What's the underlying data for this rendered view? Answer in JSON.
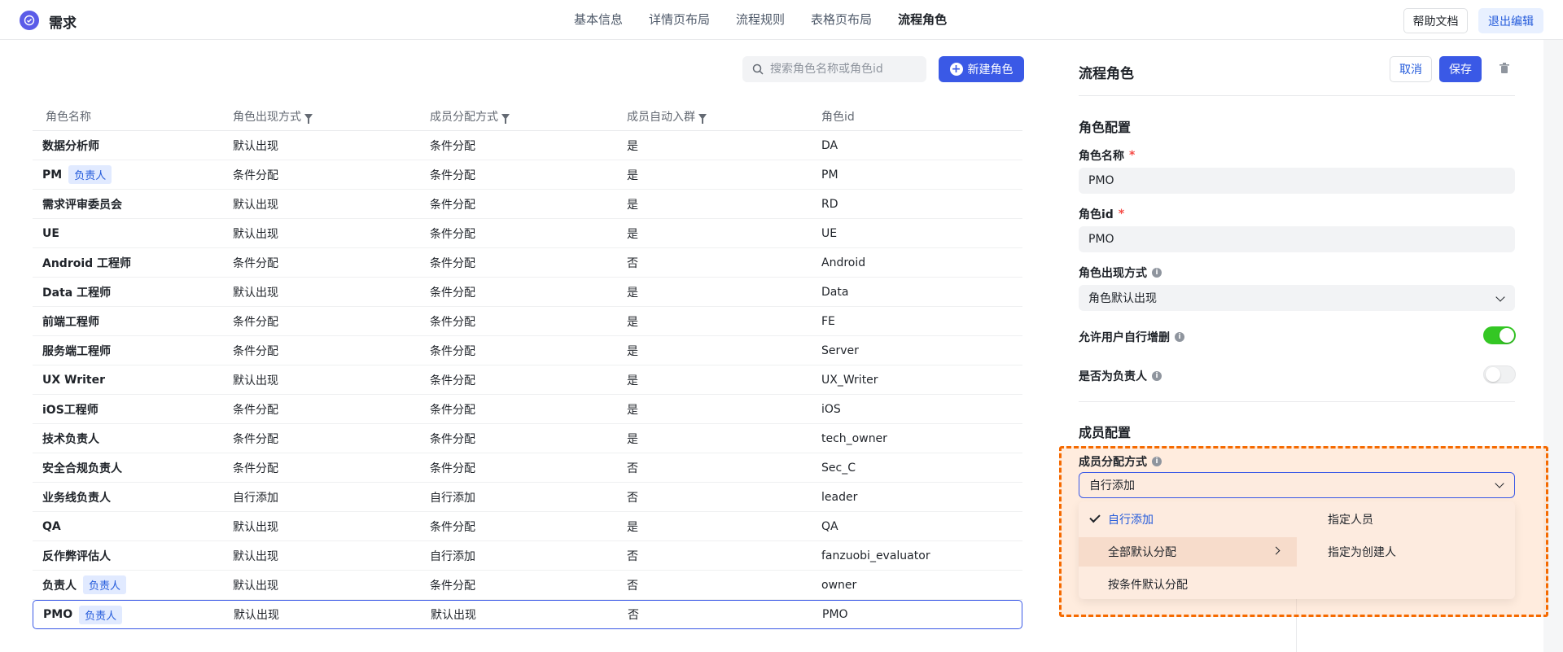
{
  "app": {
    "title": "需求"
  },
  "nav": {
    "items": [
      "基本信息",
      "详情页布局",
      "流程规则",
      "表格页布局",
      "流程角色"
    ],
    "active": 4
  },
  "header": {
    "help_label": "帮助文档",
    "exit_label": "退出编辑"
  },
  "toolbar": {
    "search_placeholder": "搜索角色名称或角色id",
    "new_label": "新建角色"
  },
  "table": {
    "columns": [
      "角色名称",
      "角色出现方式",
      "成员分配方式",
      "成员自动入群",
      "角色id"
    ],
    "rows": [
      {
        "name": "数据分析师",
        "tag": "",
        "appear": "默认出现",
        "assign": "条件分配",
        "auto": "是",
        "id": "DA"
      },
      {
        "name": "PM",
        "tag": "负责人",
        "appear": "条件分配",
        "assign": "条件分配",
        "auto": "是",
        "id": "PM"
      },
      {
        "name": "需求评审委员会",
        "tag": "",
        "appear": "默认出现",
        "assign": "条件分配",
        "auto": "是",
        "id": "RD"
      },
      {
        "name": "UE",
        "tag": "",
        "appear": "默认出现",
        "assign": "条件分配",
        "auto": "是",
        "id": "UE"
      },
      {
        "name": "Android 工程师",
        "tag": "",
        "appear": "条件分配",
        "assign": "条件分配",
        "auto": "否",
        "id": "Android"
      },
      {
        "name": "Data 工程师",
        "tag": "",
        "appear": "默认出现",
        "assign": "条件分配",
        "auto": "是",
        "id": "Data"
      },
      {
        "name": "前端工程师",
        "tag": "",
        "appear": "条件分配",
        "assign": "条件分配",
        "auto": "是",
        "id": "FE"
      },
      {
        "name": "服务端工程师",
        "tag": "",
        "appear": "条件分配",
        "assign": "条件分配",
        "auto": "是",
        "id": "Server"
      },
      {
        "name": "UX Writer",
        "tag": "",
        "appear": "默认出现",
        "assign": "条件分配",
        "auto": "是",
        "id": "UX_Writer"
      },
      {
        "name": "iOS工程师",
        "tag": "",
        "appear": "条件分配",
        "assign": "条件分配",
        "auto": "是",
        "id": "iOS"
      },
      {
        "name": "技术负责人",
        "tag": "",
        "appear": "条件分配",
        "assign": "条件分配",
        "auto": "是",
        "id": "tech_owner"
      },
      {
        "name": "安全合规负责人",
        "tag": "",
        "appear": "条件分配",
        "assign": "条件分配",
        "auto": "否",
        "id": "Sec_C"
      },
      {
        "name": "业务线负责人",
        "tag": "",
        "appear": "自行添加",
        "assign": "自行添加",
        "auto": "否",
        "id": "leader"
      },
      {
        "name": "QA",
        "tag": "",
        "appear": "默认出现",
        "assign": "条件分配",
        "auto": "是",
        "id": "QA"
      },
      {
        "name": "反作弊评估人",
        "tag": "",
        "appear": "默认出现",
        "assign": "自行添加",
        "auto": "否",
        "id": "fanzuobi_evaluator"
      },
      {
        "name": "负责人",
        "tag": "负责人",
        "appear": "默认出现",
        "assign": "条件分配",
        "auto": "否",
        "id": "owner"
      },
      {
        "name": "PMO",
        "tag": "负责人",
        "appear": "默认出现",
        "assign": "默认出现",
        "auto": "否",
        "id": "PMO"
      }
    ]
  },
  "panel": {
    "title": "流程角色",
    "cancel_label": "取消",
    "save_label": "保存",
    "role_section": "角色配置",
    "name_label": "角色名称",
    "name_value": "PMO",
    "id_label": "角色id",
    "id_value": "PMO",
    "appear_label": "角色出现方式",
    "appear_value": "角色默认出现",
    "allow_edit_label": "允许用户自行增删",
    "allow_edit_on": true,
    "is_owner_label": "是否为负责人",
    "is_owner_on": false,
    "member_section": "成员配置",
    "assign_label": "成员分配方式",
    "assign_value": "自行添加",
    "menu_left": [
      "自行添加",
      "全部默认分配",
      "按条件默认分配"
    ],
    "menu_right": [
      "指定人员",
      "指定为创建人"
    ]
  },
  "colors": {
    "accent": "#3a59e6",
    "toggle_on": "#34c724",
    "highlight": "#f56a00"
  }
}
